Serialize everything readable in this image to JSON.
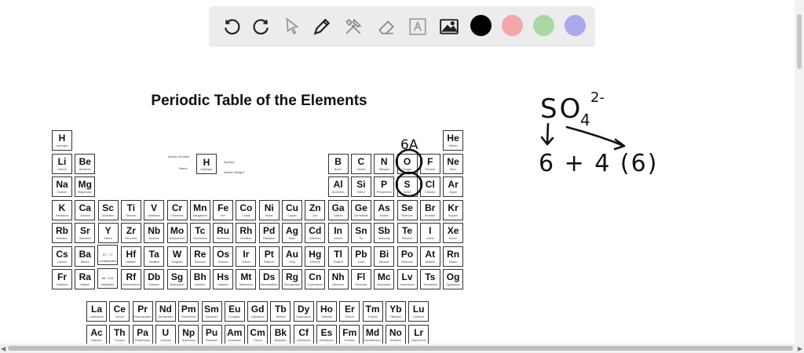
{
  "toolbar": {
    "tools": [
      "undo-icon",
      "redo-icon",
      "select-pointer-icon",
      "pen-icon",
      "tools-icon",
      "eraser-icon",
      "text-icon",
      "image-icon"
    ],
    "colors": [
      "#000000",
      "#f2a7aa",
      "#a9d8a6",
      "#a9a9ec"
    ]
  },
  "periodic_table": {
    "title": "Periodic Table of the Elements",
    "key": {
      "symbol": "H",
      "name": "Hydrogen",
      "atomic_number_label": "Atomic Number",
      "name_label": "Name",
      "symbol_label": "Symbol",
      "weight_label": "Atomic Weight"
    },
    "placeholder_lanthanides": "57 - 71 Lanthanides",
    "placeholder_actinides": "89 - 103 Actinides",
    "elements": [
      {
        "s": "H",
        "n": "Hydrogen",
        "r": 1,
        "c": 1
      },
      {
        "s": "He",
        "n": "Helium",
        "r": 1,
        "c": 18
      },
      {
        "s": "Li",
        "n": "Lithium",
        "r": 2,
        "c": 1
      },
      {
        "s": "Be",
        "n": "Beryllium",
        "r": 2,
        "c": 2
      },
      {
        "s": "B",
        "n": "Boron",
        "r": 2,
        "c": 13
      },
      {
        "s": "C",
        "n": "Carbon",
        "r": 2,
        "c": 14
      },
      {
        "s": "N",
        "n": "Nitrogen",
        "r": 2,
        "c": 15
      },
      {
        "s": "O",
        "n": "Oxygen",
        "r": 2,
        "c": 16
      },
      {
        "s": "F",
        "n": "Fluorine",
        "r": 2,
        "c": 17
      },
      {
        "s": "Ne",
        "n": "Neon",
        "r": 2,
        "c": 18
      },
      {
        "s": "Na",
        "n": "Sodium",
        "r": 3,
        "c": 1
      },
      {
        "s": "Mg",
        "n": "Magnesium",
        "r": 3,
        "c": 2
      },
      {
        "s": "Al",
        "n": "Aluminum",
        "r": 3,
        "c": 13
      },
      {
        "s": "Si",
        "n": "Silicon",
        "r": 3,
        "c": 14
      },
      {
        "s": "P",
        "n": "Phosphorus",
        "r": 3,
        "c": 15
      },
      {
        "s": "S",
        "n": "Sulfur",
        "r": 3,
        "c": 16
      },
      {
        "s": "Cl",
        "n": "Chlorine",
        "r": 3,
        "c": 17
      },
      {
        "s": "Ar",
        "n": "Argon",
        "r": 3,
        "c": 18
      },
      {
        "s": "K",
        "n": "Potassium",
        "r": 4,
        "c": 1
      },
      {
        "s": "Ca",
        "n": "Calcium",
        "r": 4,
        "c": 2
      },
      {
        "s": "Sc",
        "n": "Scandium",
        "r": 4,
        "c": 3
      },
      {
        "s": "Ti",
        "n": "Titanium",
        "r": 4,
        "c": 4
      },
      {
        "s": "V",
        "n": "Vanadium",
        "r": 4,
        "c": 5
      },
      {
        "s": "Cr",
        "n": "Chromium",
        "r": 4,
        "c": 6
      },
      {
        "s": "Mn",
        "n": "Manganese",
        "r": 4,
        "c": 7
      },
      {
        "s": "Fe",
        "n": "Iron",
        "r": 4,
        "c": 8
      },
      {
        "s": "Co",
        "n": "Cobalt",
        "r": 4,
        "c": 9
      },
      {
        "s": "Ni",
        "n": "Nickel",
        "r": 4,
        "c": 10
      },
      {
        "s": "Cu",
        "n": "Copper",
        "r": 4,
        "c": 11
      },
      {
        "s": "Zn",
        "n": "Zinc",
        "r": 4,
        "c": 12
      },
      {
        "s": "Ga",
        "n": "Gallium",
        "r": 4,
        "c": 13
      },
      {
        "s": "Ge",
        "n": "Germanium",
        "r": 4,
        "c": 14
      },
      {
        "s": "As",
        "n": "Arsenic",
        "r": 4,
        "c": 15
      },
      {
        "s": "Se",
        "n": "Selenium",
        "r": 4,
        "c": 16
      },
      {
        "s": "Br",
        "n": "Bromine",
        "r": 4,
        "c": 17
      },
      {
        "s": "Kr",
        "n": "Krypton",
        "r": 4,
        "c": 18
      },
      {
        "s": "Rb",
        "n": "Rubidium",
        "r": 5,
        "c": 1
      },
      {
        "s": "Sr",
        "n": "Strontium",
        "r": 5,
        "c": 2
      },
      {
        "s": "Y",
        "n": "Yttrium",
        "r": 5,
        "c": 3
      },
      {
        "s": "Zr",
        "n": "Zirconium",
        "r": 5,
        "c": 4
      },
      {
        "s": "Nb",
        "n": "Niobium",
        "r": 5,
        "c": 5
      },
      {
        "s": "Mo",
        "n": "Molybdenum",
        "r": 5,
        "c": 6
      },
      {
        "s": "Tc",
        "n": "Technetium",
        "r": 5,
        "c": 7
      },
      {
        "s": "Ru",
        "n": "Ruthenium",
        "r": 5,
        "c": 8
      },
      {
        "s": "Rh",
        "n": "Rhodium",
        "r": 5,
        "c": 9
      },
      {
        "s": "Pd",
        "n": "Palladium",
        "r": 5,
        "c": 10
      },
      {
        "s": "Ag",
        "n": "Silver",
        "r": 5,
        "c": 11
      },
      {
        "s": "Cd",
        "n": "Cadmium",
        "r": 5,
        "c": 12
      },
      {
        "s": "In",
        "n": "Indium",
        "r": 5,
        "c": 13
      },
      {
        "s": "Sn",
        "n": "Tin",
        "r": 5,
        "c": 14
      },
      {
        "s": "Sb",
        "n": "Antimony",
        "r": 5,
        "c": 15
      },
      {
        "s": "Te",
        "n": "Tellurium",
        "r": 5,
        "c": 16
      },
      {
        "s": "I",
        "n": "Iodine",
        "r": 5,
        "c": 17
      },
      {
        "s": "Xe",
        "n": "Xenon",
        "r": 5,
        "c": 18
      },
      {
        "s": "Cs",
        "n": "Cesium",
        "r": 6,
        "c": 1
      },
      {
        "s": "Ba",
        "n": "Barium",
        "r": 6,
        "c": 2
      },
      {
        "s": "Hf",
        "n": "Hafnium",
        "r": 6,
        "c": 4
      },
      {
        "s": "Ta",
        "n": "Tantalum",
        "r": 6,
        "c": 5
      },
      {
        "s": "W",
        "n": "Tungsten",
        "r": 6,
        "c": 6
      },
      {
        "s": "Re",
        "n": "Rhenium",
        "r": 6,
        "c": 7
      },
      {
        "s": "Os",
        "n": "Osmium",
        "r": 6,
        "c": 8
      },
      {
        "s": "Ir",
        "n": "Iridium",
        "r": 6,
        "c": 9
      },
      {
        "s": "Pt",
        "n": "Platinum",
        "r": 6,
        "c": 10
      },
      {
        "s": "Au",
        "n": "Gold",
        "r": 6,
        "c": 11
      },
      {
        "s": "Hg",
        "n": "Mercury",
        "r": 6,
        "c": 12
      },
      {
        "s": "Tl",
        "n": "Thallium",
        "r": 6,
        "c": 13
      },
      {
        "s": "Pb",
        "n": "Lead",
        "r": 6,
        "c": 14
      },
      {
        "s": "Bi",
        "n": "Bismuth",
        "r": 6,
        "c": 15
      },
      {
        "s": "Po",
        "n": "Polonium",
        "r": 6,
        "c": 16
      },
      {
        "s": "At",
        "n": "Astatine",
        "r": 6,
        "c": 17
      },
      {
        "s": "Rn",
        "n": "Radon",
        "r": 6,
        "c": 18
      },
      {
        "s": "Fr",
        "n": "Francium",
        "r": 7,
        "c": 1
      },
      {
        "s": "Ra",
        "n": "Radium",
        "r": 7,
        "c": 2
      },
      {
        "s": "Rf",
        "n": "Rutherfordium",
        "r": 7,
        "c": 4
      },
      {
        "s": "Db",
        "n": "Dubnium",
        "r": 7,
        "c": 5
      },
      {
        "s": "Sg",
        "n": "Seaborgium",
        "r": 7,
        "c": 6
      },
      {
        "s": "Bh",
        "n": "Bohrium",
        "r": 7,
        "c": 7
      },
      {
        "s": "Hs",
        "n": "Hassium",
        "r": 7,
        "c": 8
      },
      {
        "s": "Mt",
        "n": "Meitnerium",
        "r": 7,
        "c": 9
      },
      {
        "s": "Ds",
        "n": "Darmstadtium",
        "r": 7,
        "c": 10
      },
      {
        "s": "Rg",
        "n": "Roentgenium",
        "r": 7,
        "c": 11
      },
      {
        "s": "Cn",
        "n": "Copernicium",
        "r": 7,
        "c": 12
      },
      {
        "s": "Nh",
        "n": "Nihonium",
        "r": 7,
        "c": 13
      },
      {
        "s": "Fl",
        "n": "Flerovium",
        "r": 7,
        "c": 14
      },
      {
        "s": "Mc",
        "n": "Moscovium",
        "r": 7,
        "c": 15
      },
      {
        "s": "Lv",
        "n": "Livermorium",
        "r": 7,
        "c": 16
      },
      {
        "s": "Ts",
        "n": "Tennessine",
        "r": 7,
        "c": 17
      },
      {
        "s": "Og",
        "n": "Oganesson",
        "r": 7,
        "c": 18
      },
      {
        "s": "La",
        "n": "Lanthanum",
        "r": 8,
        "c": 4
      },
      {
        "s": "Ce",
        "n": "Cerium",
        "r": 8,
        "c": 5
      },
      {
        "s": "Pr",
        "n": "Praseodymium",
        "r": 8,
        "c": 6
      },
      {
        "s": "Nd",
        "n": "Neodymium",
        "r": 8,
        "c": 7
      },
      {
        "s": "Pm",
        "n": "Promethium",
        "r": 8,
        "c": 8
      },
      {
        "s": "Sm",
        "n": "Samarium",
        "r": 8,
        "c": 9
      },
      {
        "s": "Eu",
        "n": "Europium",
        "r": 8,
        "c": 10
      },
      {
        "s": "Gd",
        "n": "Gadolinium",
        "r": 8,
        "c": 11
      },
      {
        "s": "Tb",
        "n": "Terbium",
        "r": 8,
        "c": 12
      },
      {
        "s": "Dy",
        "n": "Dysprosium",
        "r": 8,
        "c": 13
      },
      {
        "s": "Ho",
        "n": "Holmium",
        "r": 8,
        "c": 14
      },
      {
        "s": "Er",
        "n": "Erbium",
        "r": 8,
        "c": 15
      },
      {
        "s": "Tm",
        "n": "Thulium",
        "r": 8,
        "c": 16
      },
      {
        "s": "Yb",
        "n": "Ytterbium",
        "r": 8,
        "c": 17
      },
      {
        "s": "Lu",
        "n": "Lutetium",
        "r": 8,
        "c": 18
      },
      {
        "s": "Ac",
        "n": "Actinium",
        "r": 9,
        "c": 4
      },
      {
        "s": "Th",
        "n": "Thorium",
        "r": 9,
        "c": 5
      },
      {
        "s": "Pa",
        "n": "Protactinium",
        "r": 9,
        "c": 6
      },
      {
        "s": "U",
        "n": "Uranium",
        "r": 9,
        "c": 7
      },
      {
        "s": "Np",
        "n": "Neptunium",
        "r": 9,
        "c": 8
      },
      {
        "s": "Pu",
        "n": "Plutonium",
        "r": 9,
        "c": 9
      },
      {
        "s": "Am",
        "n": "Americium",
        "r": 9,
        "c": 10
      },
      {
        "s": "Cm",
        "n": "Curium",
        "r": 9,
        "c": 11
      },
      {
        "s": "Bk",
        "n": "Berkelium",
        "r": 9,
        "c": 12
      },
      {
        "s": "Cf",
        "n": "Californium",
        "r": 9,
        "c": 13
      },
      {
        "s": "Es",
        "n": "Einsteinium",
        "r": 9,
        "c": 14
      },
      {
        "s": "Fm",
        "n": "Fermium",
        "r": 9,
        "c": 15
      },
      {
        "s": "Md",
        "n": "Mendelevium",
        "r": 9,
        "c": 16
      },
      {
        "s": "No",
        "n": "Nobelium",
        "r": 9,
        "c": 17
      },
      {
        "s": "Lr",
        "n": "Lawrencium",
        "r": 9,
        "c": 18
      }
    ]
  },
  "annotations": {
    "group_label": "6A",
    "formula": "SO",
    "subscript": "4",
    "charge": "2-",
    "expression": "6 + 4 (6)"
  }
}
